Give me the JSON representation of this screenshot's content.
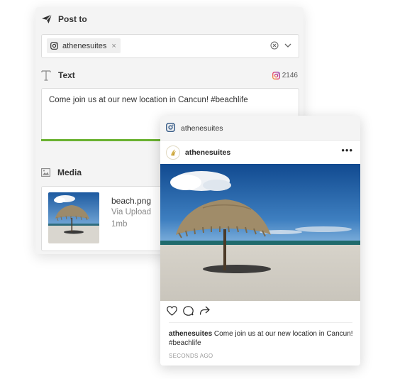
{
  "editor": {
    "post_to": {
      "title": "Post to",
      "icon": "send-icon",
      "selected_account": "athenesuites",
      "account_network_icon": "instagram-icon",
      "chip_remove_glyph": "×"
    },
    "text": {
      "title": "Text",
      "icon": "text-format-icon",
      "char_count": "2146",
      "body": "Come join us at our new location in Cancun! #beachlife",
      "progress_fraction": 0.62,
      "progress_color": "#6ab231"
    },
    "media": {
      "title": "Media",
      "icon": "image-icon",
      "file_name": "beach.png",
      "source": "Via Upload",
      "size": "1mb"
    }
  },
  "preview": {
    "network_label": "athenesuites",
    "network_icon": "instagram-icon",
    "username": "athenesuites",
    "more_glyph": "•••",
    "caption_user": "athenesuites",
    "caption_text": " Come join us at our new location in Cancun! #beachlife",
    "timestamp": "SECONDS AGO",
    "action_icons": [
      "heart-icon",
      "comment-icon",
      "share-icon"
    ]
  },
  "colors": {
    "accent_green": "#6ab231",
    "instagram_blue": "#3b5f8a",
    "panel_bg": "#f4f4f4"
  }
}
